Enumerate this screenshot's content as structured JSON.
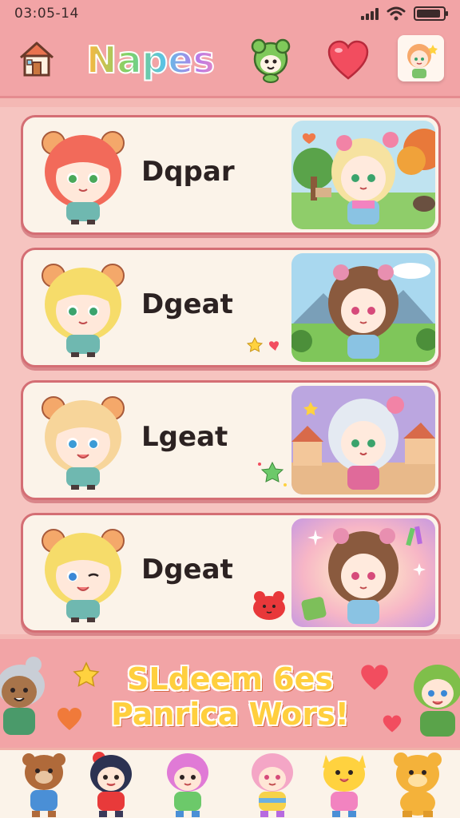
{
  "status": {
    "time": "03:05-14",
    "battery_level": 0.9
  },
  "header": {
    "title": "Napes",
    "icons": [
      "home-icon",
      "mascot-icon",
      "heart-icon",
      "profile-avatar"
    ]
  },
  "characters": [
    {
      "name": "Dqpar",
      "hair": "#f26a5a",
      "eyes": "#4aa85a",
      "scene": "forest"
    },
    {
      "name": "Dgeat",
      "hair": "#f6dc6a",
      "eyes": "#3aa36c",
      "scene": "mountains"
    },
    {
      "name": "Lgeat",
      "hair": "#f7d59a",
      "eyes": "#3b9bd6",
      "scene": "village"
    },
    {
      "name": "Dgeat",
      "hair": "#f6dc6a",
      "eyes": "#3b88d6",
      "scene": "sparkle"
    }
  ],
  "banner": {
    "line1": "SLdeem 6es",
    "line2": "Panrica Wors!"
  },
  "colors": {
    "accent": "#f2a4a6",
    "card_border": "#d46e74",
    "card_bg": "#fbf3e9",
    "banner_text": "#ffcf3e"
  },
  "bottom_characters": [
    "bear-character-icon",
    "dark-hair-character-icon",
    "pink-hair-character-icon",
    "pink-girl-character-icon",
    "yellow-cat-character-icon",
    "yellow-bear-character-icon"
  ]
}
